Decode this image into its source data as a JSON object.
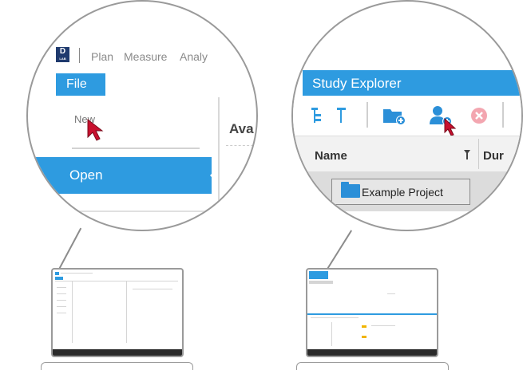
{
  "left_magnifier": {
    "logo_text": "D",
    "logo_sub": "LAB",
    "menu_items": [
      "Plan",
      "Measure",
      "Analy"
    ],
    "file_tab": "File",
    "new_label": "New",
    "open_label": "Open",
    "partial_heading": "Ava"
  },
  "right_magnifier": {
    "panel_title": "Study Explorer",
    "column_name": "Name",
    "column_duration": "Dur",
    "project_name": "Example Project"
  },
  "colors": {
    "accent_blue": "#2e9be0",
    "cursor_red": "#c8102e",
    "folder_blue": "#2b8fd8",
    "outline_gray": "#9a9a9a"
  },
  "icons": [
    "expand-tree-icon",
    "collapse-tree-icon",
    "add-folder-icon",
    "add-participant-icon",
    "delete-icon",
    "filter-icon",
    "cursor-arrow-icon",
    "folder-icon"
  ]
}
